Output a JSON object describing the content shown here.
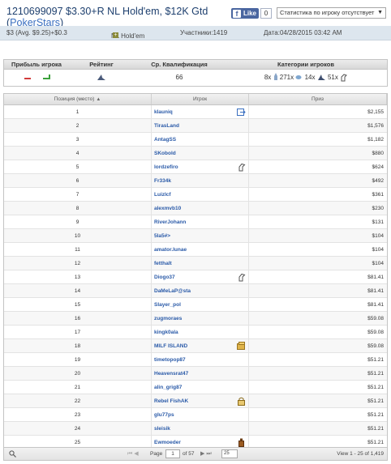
{
  "header": {
    "title": "1210699097 $3.30+R NL Hold'em, $12K Gtd",
    "network_open": "(",
    "network": "PokerStars",
    "network_close": ")",
    "fb_like_label": "Like",
    "fb_like_count": "0",
    "stats_select": "Статистика по игроку отсутствует"
  },
  "info_bar": {
    "buyin": "$3 (Avg. $9.25)+$0.3",
    "game": "NL Hold'em",
    "participants": "Участники:1419",
    "date": "Дата:04/28/2015 03:42 AM"
  },
  "summary": {
    "headers": [
      "Прибыль игрока",
      "Рейтинг",
      "Ср. Квалификация",
      "Категории игроков"
    ],
    "avg_qualification": "66",
    "categories": [
      {
        "count": "8x",
        "icon": "rocket-icon"
      },
      {
        "count": "271x",
        "icon": "fish-icon"
      },
      {
        "count": "14x",
        "icon": "shark-icon"
      },
      {
        "count": "51x",
        "icon": "horse-icon"
      }
    ]
  },
  "table": {
    "headers": {
      "position": "Позиция (место)",
      "player": "Игрок",
      "prize": "Приз"
    },
    "rows": [
      {
        "pos": "1",
        "player": "klauniq",
        "prize": "$2,155",
        "icon": "export-icon"
      },
      {
        "pos": "2",
        "player": "TirasLand",
        "prize": "$1,576",
        "icon": ""
      },
      {
        "pos": "3",
        "player": "AntagSS",
        "prize": "$1,182",
        "icon": ""
      },
      {
        "pos": "4",
        "player": "SKobold",
        "prize": "$880",
        "icon": ""
      },
      {
        "pos": "5",
        "player": "lordzefiro",
        "prize": "$624",
        "icon": "horse-icon"
      },
      {
        "pos": "6",
        "player": "Fr334k",
        "prize": "$492",
        "icon": ""
      },
      {
        "pos": "7",
        "player": "Luizlcf",
        "prize": "$361",
        "icon": ""
      },
      {
        "pos": "8",
        "player": "alexmvb10",
        "prize": "$230",
        "icon": ""
      },
      {
        "pos": "9",
        "player": "RiverJohann",
        "prize": "$131",
        "icon": ""
      },
      {
        "pos": "10",
        "player": "5la5#>",
        "prize": "$104",
        "icon": ""
      },
      {
        "pos": "11",
        "player": "amator.lunae",
        "prize": "$104",
        "icon": ""
      },
      {
        "pos": "12",
        "player": "fetthalt",
        "prize": "$104",
        "icon": ""
      },
      {
        "pos": "13",
        "player": "Diogo37",
        "prize": "$81.41",
        "icon": "horse-icon"
      },
      {
        "pos": "14",
        "player": "DaMeLaP@sta",
        "prize": "$81.41",
        "icon": ""
      },
      {
        "pos": "15",
        "player": "Slayer_pol",
        "prize": "$81.41",
        "icon": ""
      },
      {
        "pos": "16",
        "player": "zugmoraes",
        "prize": "$59.08",
        "icon": ""
      },
      {
        "pos": "17",
        "player": "kingk0ala",
        "prize": "$59.08",
        "icon": ""
      },
      {
        "pos": "18",
        "player": "MILF ISLAND",
        "prize": "$59.08",
        "icon": "money-icon"
      },
      {
        "pos": "19",
        "player": "timetopop87",
        "prize": "$51.21",
        "icon": ""
      },
      {
        "pos": "20",
        "player": "Heavensrat47",
        "prize": "$51.21",
        "icon": ""
      },
      {
        "pos": "21",
        "player": "alin_grig87",
        "prize": "$51.21",
        "icon": ""
      },
      {
        "pos": "22",
        "player": "Rebel FishAK",
        "prize": "$51.21",
        "icon": "lock-icon"
      },
      {
        "pos": "23",
        "player": "glu77ps",
        "prize": "$51.21",
        "icon": ""
      },
      {
        "pos": "24",
        "player": "sleisik",
        "prize": "$51.21",
        "icon": ""
      },
      {
        "pos": "25",
        "player": "Ewmoeder",
        "prize": "$51.21",
        "icon": "bottle-icon"
      }
    ]
  },
  "pager": {
    "page_label": "Page",
    "page_value": "1",
    "of_label": "of 57",
    "page_size": "25",
    "view": "View 1 - 25 of 1,419"
  }
}
